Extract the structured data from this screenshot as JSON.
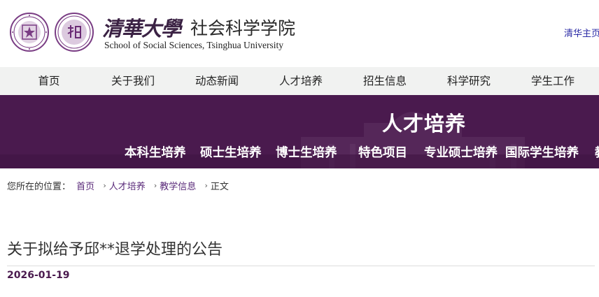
{
  "header": {
    "brand_calligraphy": "清華大學",
    "brand_name": "社会科学学院",
    "brand_en": "School of Social Sciences, Tsinghua University",
    "top_link": "清华主页"
  },
  "colors": {
    "brand_purple": "#4a1a4e",
    "link_blue": "#2b2ba6",
    "nav_bg": "#f1f2f1"
  },
  "nav": {
    "items": [
      {
        "label": "首页"
      },
      {
        "label": "关于我们"
      },
      {
        "label": "动态新闻"
      },
      {
        "label": "人才培养"
      },
      {
        "label": "招生信息"
      },
      {
        "label": "科学研究"
      },
      {
        "label": "学生工作"
      }
    ]
  },
  "banner": {
    "title": "人才培养",
    "subnav": [
      {
        "label": "本科生培养"
      },
      {
        "label": "硕士生培养"
      },
      {
        "label": "博士生培养"
      },
      {
        "label": "特色项目"
      },
      {
        "label": "专业硕士培养"
      },
      {
        "label": "国际学生培养"
      },
      {
        "label": "教"
      }
    ]
  },
  "breadcrumb": {
    "prefix": "您所在的位置：",
    "items": [
      {
        "label": "首页"
      },
      {
        "label": "人才培养"
      },
      {
        "label": "教学信息"
      },
      {
        "label": "正文"
      }
    ]
  },
  "article": {
    "title": "关于拟给予邱**退学处理的公告",
    "date": "2026-01-19"
  }
}
